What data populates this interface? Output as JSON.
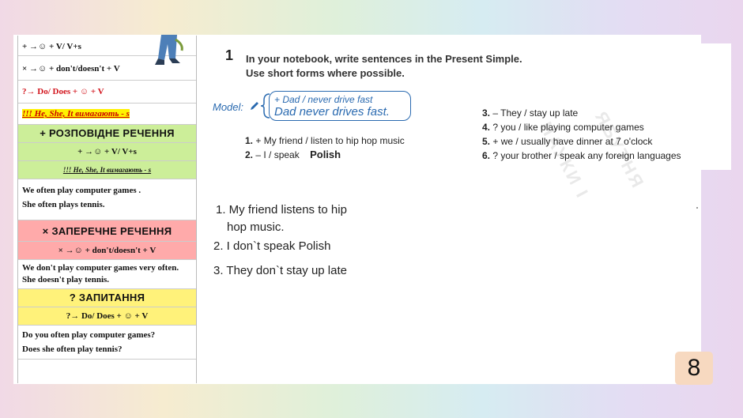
{
  "grammar": {
    "rows_top": [
      "+ →☺ + V/ V+s",
      "× →☺ + don't/doesn't + V",
      "?→ Do/ Does + ☺ + V",
      "!!! He, She, It вимагають - s"
    ],
    "affirmative": {
      "title": "+ РОЗПОВІДНЕ РЕЧЕННЯ",
      "formula": "+ →☺ + V/ V+s",
      "note": "!!! He, She, It вимагають - s",
      "ex1": "We often play computer games .",
      "ex2": "She often plays tennis."
    },
    "negative": {
      "title": "× ЗАПЕРЕЧНЕ РЕЧЕННЯ",
      "formula": "× →☺ + don't/doesn't + V",
      "ex1": "We don't play computer games very often.",
      "ex2": "She doesn't play tennis."
    },
    "question": {
      "title": "? ЗАПИТАННЯ",
      "formula": "?→ Do/ Does + ☺ + V",
      "ex1": "Do you often play computer games?",
      "ex2": "Does she often play tennis?"
    }
  },
  "exercise": {
    "number": "1",
    "instruction_line1": "In your notebook, write sentences in the Present Simple.",
    "instruction_line2": "Use short forms where possible.",
    "model_label": "Model:",
    "model_prompt": "+ Dad / never drive fast",
    "model_answer": "Dad never drives fast.",
    "items": [
      {
        "num": "1.",
        "text": "+ My friend / listen to hip hop music"
      },
      {
        "num": "2.",
        "text": "– I / speak",
        "fill": "Polish"
      },
      {
        "num": "3.",
        "text": "– They / stay up late"
      },
      {
        "num": "4.",
        "text": "? you / like playing computer games"
      },
      {
        "num": "5.",
        "text": "+ we / usually have dinner at 7 o'clock"
      },
      {
        "num": "6.",
        "text": "? your brother / speak any foreign languages"
      }
    ],
    "watermark1": "НАУКИ І",
    "watermark2": "ЯБУТНЯ"
  },
  "answers": {
    "a1_line1": "1. My friend listens to hip",
    "a1_line2": "hop music.",
    "a2": "2. I don`t speak Polish",
    "a3": "3. They don`t stay up late"
  },
  "page_number": "8",
  "colors": {
    "red": "#d2141c",
    "green_band": "#ccee99",
    "red_band": "#ffaaaa",
    "yellow_band": "#fff27a",
    "model_blue": "#2a6ab0",
    "page_badge": "#f7d9c0"
  }
}
